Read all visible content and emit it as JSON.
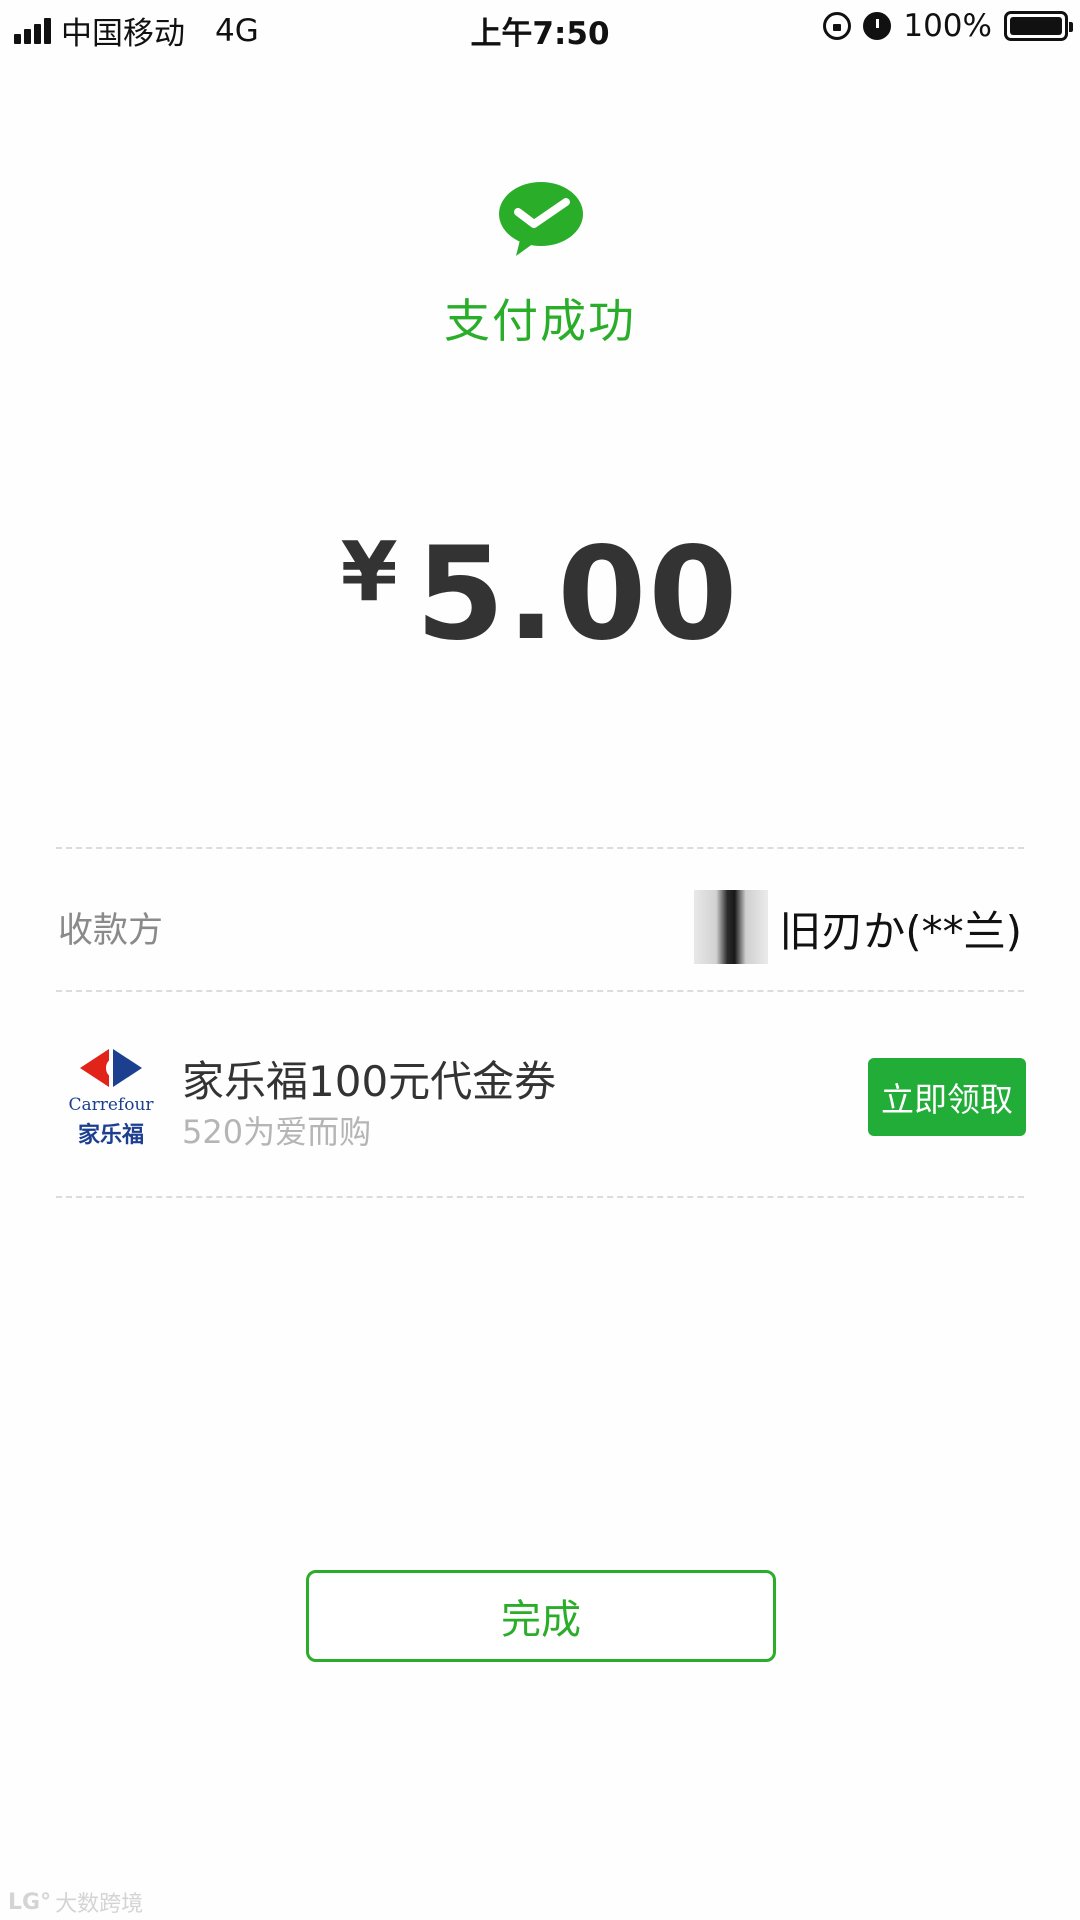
{
  "status_bar": {
    "carrier": "中国移动",
    "network": "4G",
    "time": "上午7:50",
    "battery": "100%"
  },
  "result": {
    "title": "支付成功",
    "currency_symbol": "¥",
    "amount": "5.00"
  },
  "payee": {
    "label": "收款方",
    "name": "旧刃か(**兰)"
  },
  "coupon": {
    "title": "家乐福100元代金券",
    "subtitle": "520为爱而购",
    "button_label": "立即领取",
    "logo_text_en": "Carrefour",
    "logo_text_cn": "家乐福"
  },
  "done_button": {
    "label": "完成"
  },
  "watermark": {
    "text": "大数跨境"
  },
  "colors": {
    "accent_green": "#2aae2a",
    "button_green": "#22ac38",
    "carrefour_blue": "#1c3f8f",
    "carrefour_red": "#e2231a"
  }
}
